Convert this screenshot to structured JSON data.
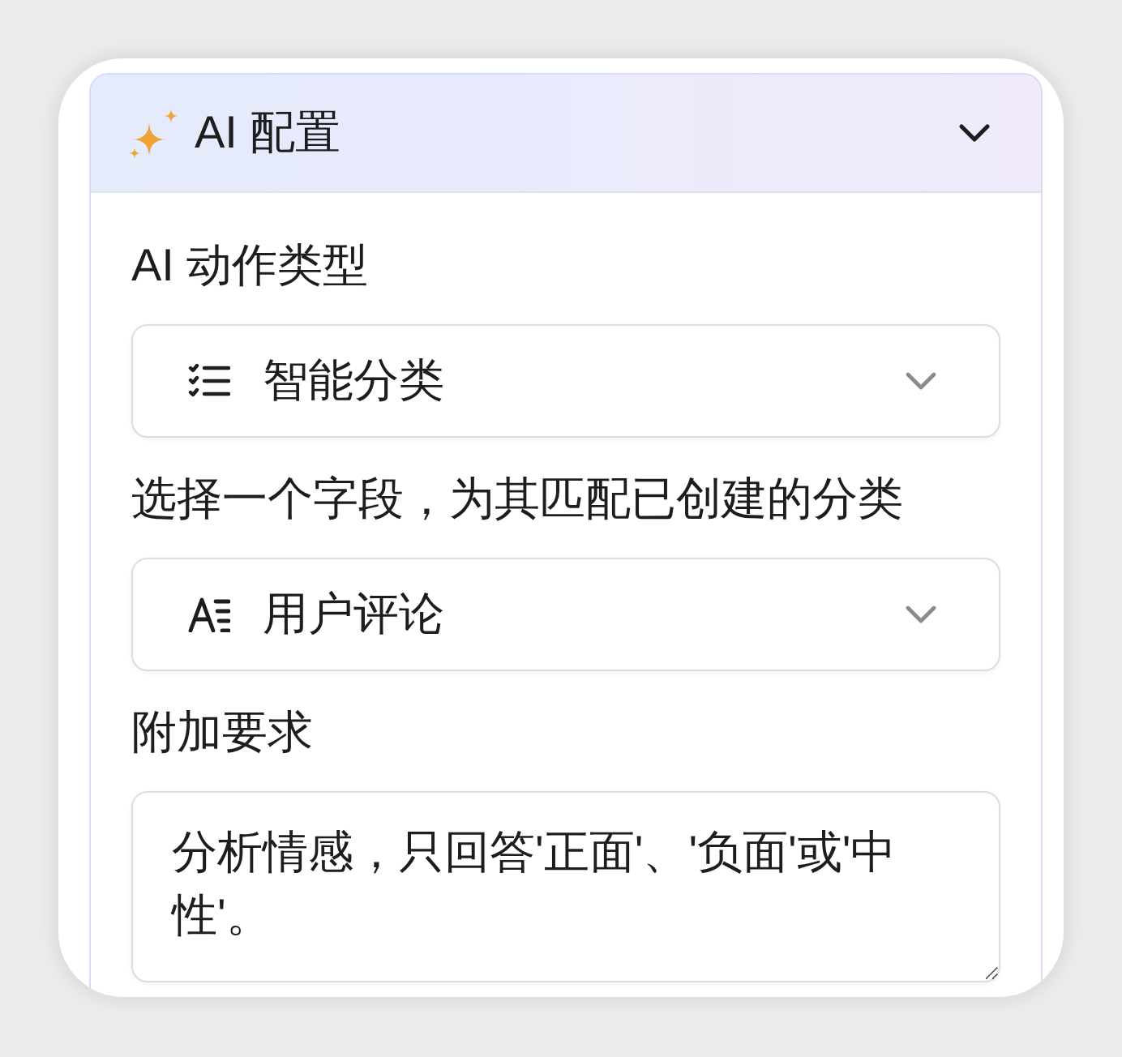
{
  "panel": {
    "title": "AI 配置",
    "expanded": true
  },
  "fields": [
    {
      "kind": "action",
      "label": "AI 动作类型",
      "value": "智能分类"
    },
    {
      "kind": "field",
      "label": "选择一个字段，为其匹配已创建的分类",
      "value": "用户评论"
    },
    {
      "kind": "text",
      "label": "附加要求",
      "value": "分析情感，只回答'正面'、'负面'或'中性'。"
    }
  ]
}
